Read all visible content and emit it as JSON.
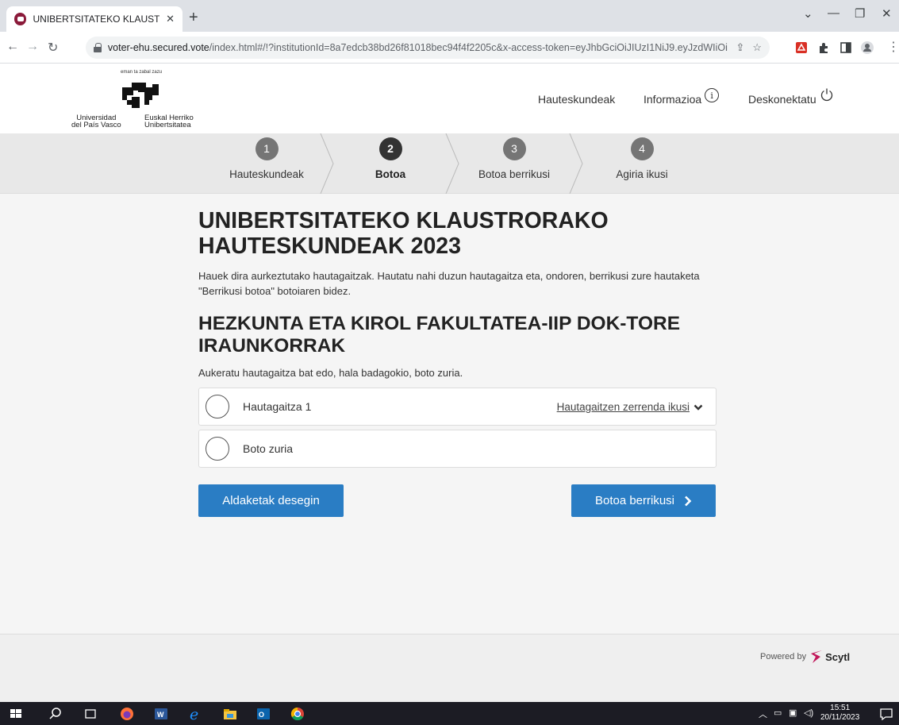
{
  "browser": {
    "tab_title": "UNIBERTSITATEKO KLAUSTRORA",
    "url_host": "voter-ehu.secured.vote",
    "url_rest": "/index.html#/!?institutionId=8a7edcb38bd26f81018bec94f4f2205c&x-access-token=eyJhbGciOiJIUzI1NiJ9.eyJzdWIiOiJIN..."
  },
  "logo": {
    "motto": "eman ta zabal zazu",
    "name_es_1": "Universidad",
    "name_es_2": "del País Vasco",
    "name_eu_1": "Euskal Herriko",
    "name_eu_2": "Unibertsitatea"
  },
  "nav": {
    "elections": "Hauteskundeak",
    "info": "Informazioa",
    "logout": "Deskonektatu"
  },
  "steps": [
    {
      "num": "1",
      "label": "Hauteskundeak"
    },
    {
      "num": "2",
      "label": "Botoa"
    },
    {
      "num": "3",
      "label": "Botoa berrikusi"
    },
    {
      "num": "4",
      "label": "Agiria ikusi"
    }
  ],
  "content": {
    "title": "UNIBERTSITATEKO KLAUSTRORAKO HAUTESKUNDEAK 2023",
    "intro": "Hauek dira aurkeztutako hautagaitzak. Hautatu nahi duzun hautagaitza eta, ondoren, berrikusi zure hautaketa \"Berrikusi botoa\" botoiaren bidez.",
    "subtitle": "HEZKUNTA ETA KIROL FAKULTATEA-IIP DOK-TORE IRAUNKORRAK",
    "instruction": "Aukeratu hautagaitza bat edo, hala badagokio, boto zuria.",
    "options": [
      {
        "label": "Hautagaitza 1",
        "link": "Hautagaitzen zerrenda ikusi"
      },
      {
        "label": "Boto zuria"
      }
    ],
    "undo_button": "Aldaketak desegin",
    "review_button": "Botoa berrikusi"
  },
  "footer": {
    "powered_by": "Powered by",
    "brand": "Scytl"
  },
  "taskbar": {
    "time": "15:51",
    "date": "20/11/2023"
  },
  "colors": {
    "primary_button": "#2a7dc4",
    "step_active": "#333333",
    "step_inactive": "#757575"
  }
}
